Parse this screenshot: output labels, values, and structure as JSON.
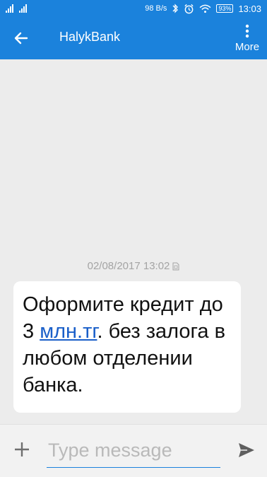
{
  "status_bar": {
    "net_speed": "98 B/s",
    "battery": "93%",
    "time": "13:03",
    "icons": [
      "signal-icon",
      "signal-icon",
      "bluetooth-icon",
      "alarm-icon",
      "wifi-icon",
      "battery-icon"
    ]
  },
  "app_bar": {
    "title": "HalykBank",
    "more_label": "More",
    "icons": [
      "back-arrow-icon",
      "more-vert-icon"
    ]
  },
  "conversation": {
    "timestamp": "02/08/2017 13:02",
    "message": {
      "part1": "Оформите кредит до 3 ",
      "link": "млн.тг",
      "part2": ". без залога в любом отделении банка."
    }
  },
  "compose": {
    "placeholder": "Type message",
    "icons": [
      "plus-icon",
      "send-icon"
    ]
  },
  "colors": {
    "primary": "#1b82dc",
    "background": "#ececec",
    "link": "#1a5fc9"
  }
}
